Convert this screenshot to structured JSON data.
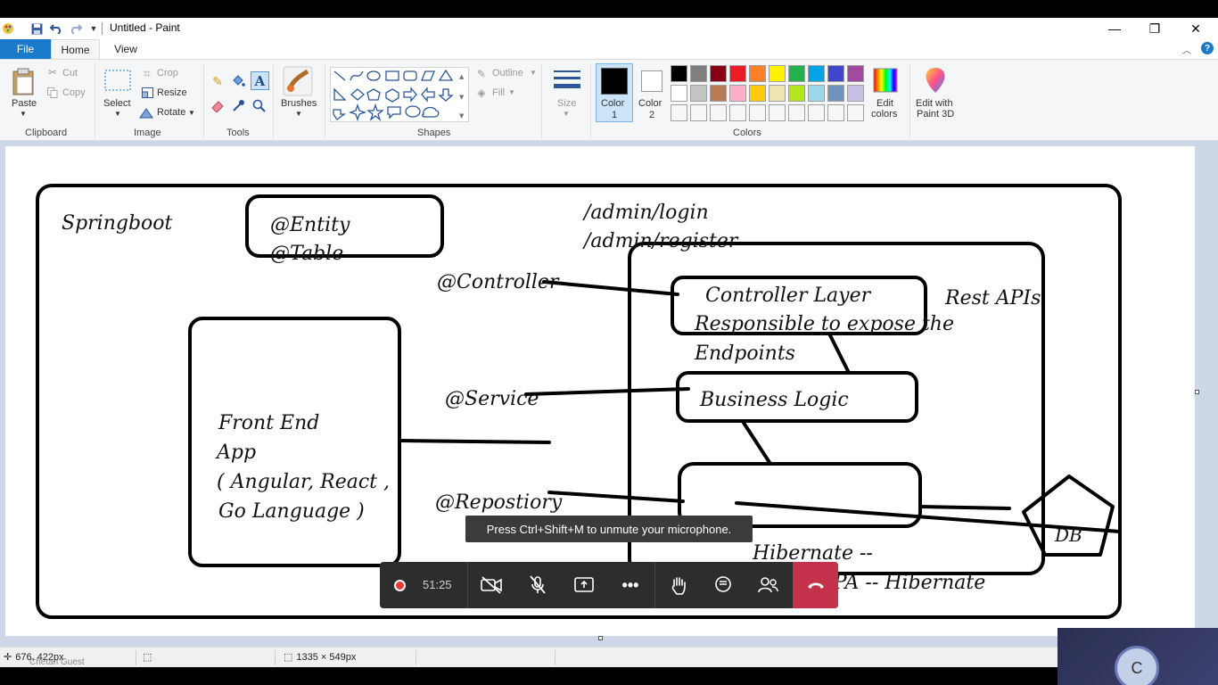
{
  "window": {
    "title": "Untitled - Paint",
    "minimize": "—",
    "restore": "❐",
    "close": "✕"
  },
  "tabs": {
    "file": "File",
    "home": "Home",
    "view": "View"
  },
  "ribbon": {
    "clipboard": {
      "paste": "Paste",
      "cut": "Cut",
      "copy": "Copy",
      "label": "Clipboard"
    },
    "image": {
      "select": "Select",
      "crop": "Crop",
      "resize": "Resize",
      "rotate": "Rotate",
      "label": "Image"
    },
    "tools": {
      "label": "Tools"
    },
    "brushes": {
      "label": "Brushes"
    },
    "shapes": {
      "outline": "Outline",
      "fill": "Fill",
      "label": "Shapes"
    },
    "size": {
      "label": "Size"
    },
    "colors": {
      "color1": "Color",
      "color1_num": "1",
      "color2": "Color",
      "color2_num": "2",
      "edit_colors": "Edit",
      "edit_colors_2": "colors",
      "paint3d": "Edit with",
      "paint3d_2": "Paint 3D",
      "label": "Colors",
      "palette_row1": [
        "#000000",
        "#7f7f7f",
        "#880015",
        "#ed1c24",
        "#ff7f27",
        "#fff200",
        "#22b14c",
        "#00a2e8",
        "#3f48cc",
        "#a349a4"
      ],
      "palette_row2": [
        "#ffffff",
        "#c3c3c3",
        "#b97a57",
        "#ffaec9",
        "#ffc90e",
        "#efe4b0",
        "#b5e61d",
        "#99d9ea",
        "#7092be",
        "#c8bfe7"
      ]
    }
  },
  "drawing": {
    "springboot": "Springboot",
    "entity": "@Entity",
    "table": "@Table",
    "admin_login": "/admin/login",
    "admin_register": "/admin/register",
    "controller_annot": "@Controller",
    "controller_layer": "Controller Layer",
    "responsible": "Responsible to expose the",
    "endpoints": "Endpoints",
    "rest_apis": "Rest APIs",
    "service_annot": "@Service",
    "business_logic": "Business Logic",
    "front_end": "Front End",
    "app": "App",
    "angular_react": "( Angular, React ,",
    "go_language": "Go Language )",
    "repository_annot": "@Repostiory",
    "db": "DB",
    "hibernate": "Hibernate --",
    "jpa_hibernate": "Spring JPA -- Hibernate"
  },
  "status": {
    "cursor_pos": "676, 422px",
    "canvas_size": "1335 × 549px",
    "guest": "Chetan Guest"
  },
  "toast": "Press Ctrl+Shift+M to unmute your microphone.",
  "meeting": {
    "timer": "51:25",
    "avatar_initial": "C"
  }
}
